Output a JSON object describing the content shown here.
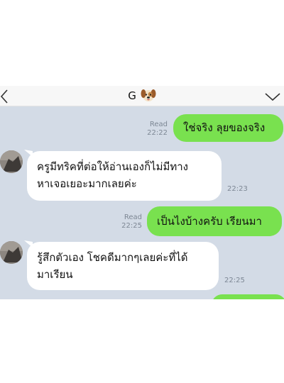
{
  "header": {
    "title": "G",
    "title_icon": "dog-face-emoji",
    "back_icon": "chevron-left-icon",
    "menu_icon": "chevron-down-icon"
  },
  "colors": {
    "outgoing_bubble": "#79e14f",
    "incoming_bubble": "#ffffff",
    "chat_background": "#d3dbe6",
    "meta_text": "#7d8794"
  },
  "messages": [
    {
      "direction": "out",
      "text": "ใช่จริง ลุยของจริง",
      "read": "Read",
      "time": "22:22"
    },
    {
      "direction": "in",
      "lines": [
        "ครูมีทริคที่ต่อให้อ่านเองก็ไม่มีทาง",
        "หาเจอเยอะมากเลยค่ะ"
      ],
      "time": "22:23"
    },
    {
      "direction": "out",
      "text": "เป็นไงบ้างครับ เรียนมา",
      "read": "Read",
      "time": "22:25"
    },
    {
      "direction": "in",
      "lines": [
        "รู้สึกตัวเอง โชคดีมากๆเลยค่ะที่ได้",
        "มาเรียน"
      ],
      "time": "22:25"
    }
  ]
}
